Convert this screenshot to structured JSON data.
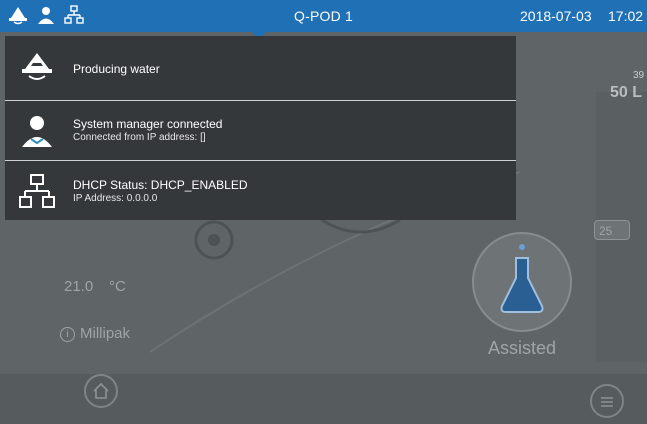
{
  "topbar": {
    "title": "Q-POD 1",
    "date": "2018-07-03",
    "time": "17:02",
    "icons": [
      "water-drop-icon",
      "user-icon",
      "network-icon"
    ],
    "color": "#1f70b5"
  },
  "background": {
    "volume_small": "39",
    "volume": "50 L",
    "temperature_value": "21.0",
    "temperature_unit": "°C",
    "filter_label": "Millipak",
    "mode_label": "Assisted",
    "volume_preset": "25"
  },
  "notifications": [
    {
      "title": "Producing water",
      "subtitle": "",
      "icon": "water-drop-icon"
    },
    {
      "title": "System manager connected",
      "subtitle": "Connected from IP address: []",
      "icon": "user-icon"
    },
    {
      "title": "DHCP Status: DHCP_ENABLED",
      "subtitle": "IP Address: 0.0.0.0",
      "icon": "network-icon"
    }
  ],
  "bottom": {
    "home_icon": "home-icon",
    "menu_icon": "menu-icon"
  }
}
